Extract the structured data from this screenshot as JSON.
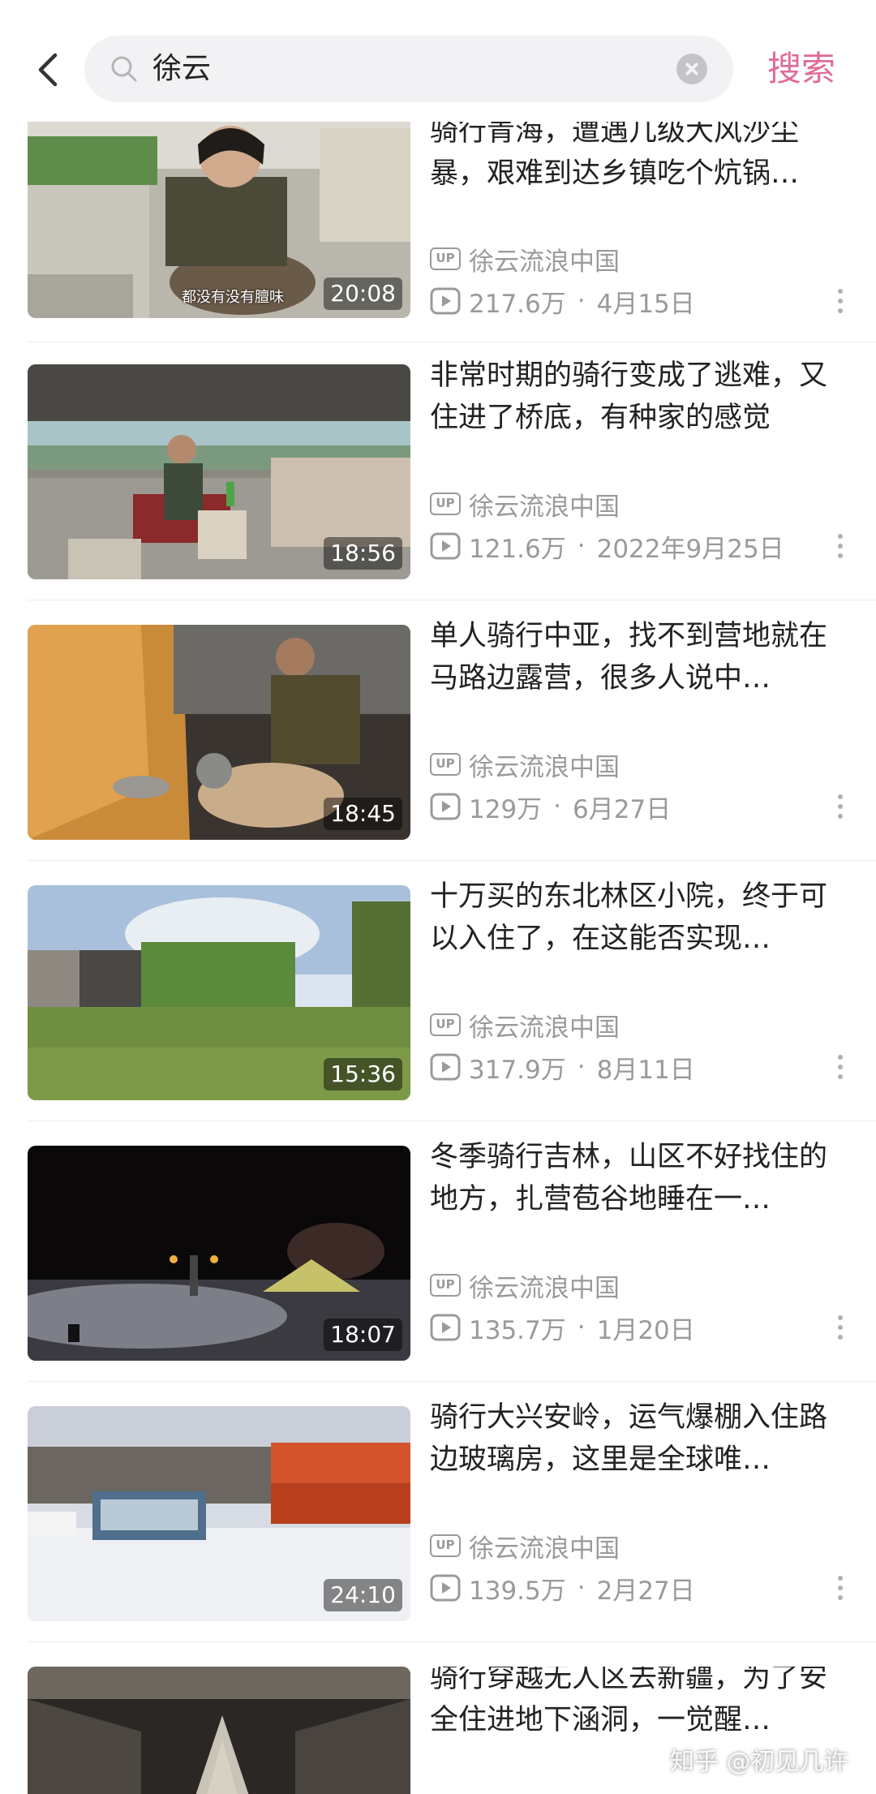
{
  "search": {
    "query": "徐云",
    "submit_label": "搜索"
  },
  "videos": [
    {
      "title": "骑行青海，遭遇几级大风沙尘暴，艰难到达乡镇吃个炕锅…",
      "author": "徐云流浪中国",
      "views": "217.6万",
      "date": "4月15日",
      "duration": "20:08",
      "subtitle": "都没有没有膻味"
    },
    {
      "title": "非常时期的骑行变成了逃难，又住进了桥底，有种家的感觉",
      "author": "徐云流浪中国",
      "views": "121.6万",
      "date": "2022年9月25日",
      "duration": "18:56"
    },
    {
      "title": "单人骑行中亚，找不到营地就在马路边露营，很多人说中…",
      "author": "徐云流浪中国",
      "views": "129万",
      "date": "6月27日",
      "duration": "18:45"
    },
    {
      "title": "十万买的东北林区小院，终于可以入住了，在这能否实现…",
      "author": "徐云流浪中国",
      "views": "317.9万",
      "date": "8月11日",
      "duration": "15:36"
    },
    {
      "title": "冬季骑行吉林，山区不好找住的地方，扎营苞谷地睡在一…",
      "author": "徐云流浪中国",
      "views": "135.7万",
      "date": "1月20日",
      "duration": "18:07"
    },
    {
      "title": "骑行大兴安岭，运气爆棚入住路边玻璃房，这里是全球唯…",
      "author": "徐云流浪中国",
      "views": "139.5万",
      "date": "2月27日",
      "duration": "24:10"
    },
    {
      "title": "骑行穿越无人区去新疆，为了安全住进地下涵洞，一觉醒…",
      "author": "徐云流浪中国",
      "views": "",
      "date": "",
      "duration": ""
    }
  ],
  "up_badge": "UP",
  "watermark": "知乎 @初见几许",
  "colors": {
    "accent": "#e06b98",
    "meta_gray": "#9a9a9a"
  }
}
